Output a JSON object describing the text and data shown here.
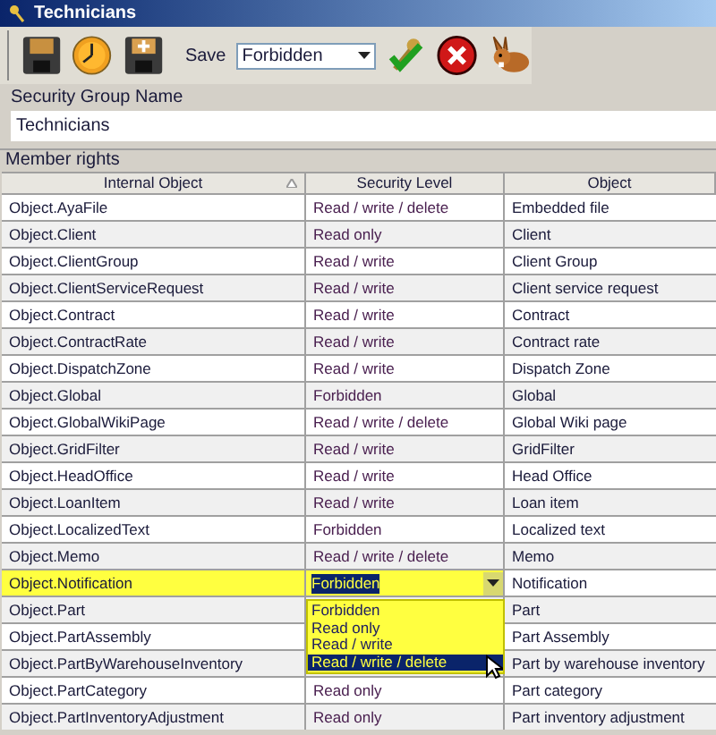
{
  "window": {
    "title": "Technicians"
  },
  "toolbar": {
    "save_label": "Save",
    "save_dropdown": {
      "value": "Forbidden"
    }
  },
  "group_name": {
    "label": "Security Group Name",
    "value": "Technicians"
  },
  "member_rights": {
    "title": "Member rights",
    "columns": [
      {
        "label": "Internal Object",
        "sorted": true
      },
      {
        "label": "Security Level",
        "sorted": false
      },
      {
        "label": "Object",
        "sorted": false
      }
    ],
    "rows": [
      {
        "internal_object": "Object.AyaFile",
        "security_level": "Read / write / delete",
        "object": "Embedded file",
        "selected": false
      },
      {
        "internal_object": "Object.Client",
        "security_level": "Read only",
        "object": "Client",
        "selected": false
      },
      {
        "internal_object": "Object.ClientGroup",
        "security_level": "Read / write",
        "object": "Client Group",
        "selected": false
      },
      {
        "internal_object": "Object.ClientServiceRequest",
        "security_level": "Read / write",
        "object": "Client service request",
        "selected": false
      },
      {
        "internal_object": "Object.Contract",
        "security_level": "Read / write",
        "object": "Contract",
        "selected": false
      },
      {
        "internal_object": "Object.ContractRate",
        "security_level": "Read / write",
        "object": "Contract rate",
        "selected": false
      },
      {
        "internal_object": "Object.DispatchZone",
        "security_level": "Read / write",
        "object": "Dispatch Zone",
        "selected": false
      },
      {
        "internal_object": "Object.Global",
        "security_level": "Forbidden",
        "object": "Global",
        "selected": false
      },
      {
        "internal_object": "Object.GlobalWikiPage",
        "security_level": "Read / write / delete",
        "object": "Global Wiki page",
        "selected": false
      },
      {
        "internal_object": "Object.GridFilter",
        "security_level": "Read / write",
        "object": "GridFilter",
        "selected": false
      },
      {
        "internal_object": "Object.HeadOffice",
        "security_level": "Read / write",
        "object": "Head Office",
        "selected": false
      },
      {
        "internal_object": "Object.LoanItem",
        "security_level": "Read / write",
        "object": "Loan item",
        "selected": false
      },
      {
        "internal_object": "Object.LocalizedText",
        "security_level": "Forbidden",
        "object": "Localized text",
        "selected": false
      },
      {
        "internal_object": "Object.Memo",
        "security_level": "Read / write / delete",
        "object": "Memo",
        "selected": false
      },
      {
        "internal_object": "Object.Notification",
        "security_level": "Forbidden",
        "object": "Notification",
        "selected": true
      },
      {
        "internal_object": "Object.Part",
        "object": "Part",
        "selected": false
      },
      {
        "internal_object": "Object.PartAssembly",
        "object": "Part Assembly",
        "selected": false
      },
      {
        "internal_object": "Object.PartByWarehouseInventory",
        "object": "Part by warehouse inventory",
        "selected": false
      },
      {
        "internal_object": "Object.PartCategory",
        "security_level": "Read only",
        "object": "Part category",
        "selected": false
      },
      {
        "internal_object": "Object.PartInventoryAdjustment",
        "security_level": "Read only",
        "object": "Part inventory adjustment",
        "selected": false
      }
    ],
    "level_dropdown": {
      "options": [
        {
          "label": "Forbidden",
          "selected": false
        },
        {
          "label": "Read only",
          "selected": false
        },
        {
          "label": "Read / write",
          "selected": false
        },
        {
          "label": "Read / write / delete",
          "selected": true
        }
      ]
    }
  }
}
